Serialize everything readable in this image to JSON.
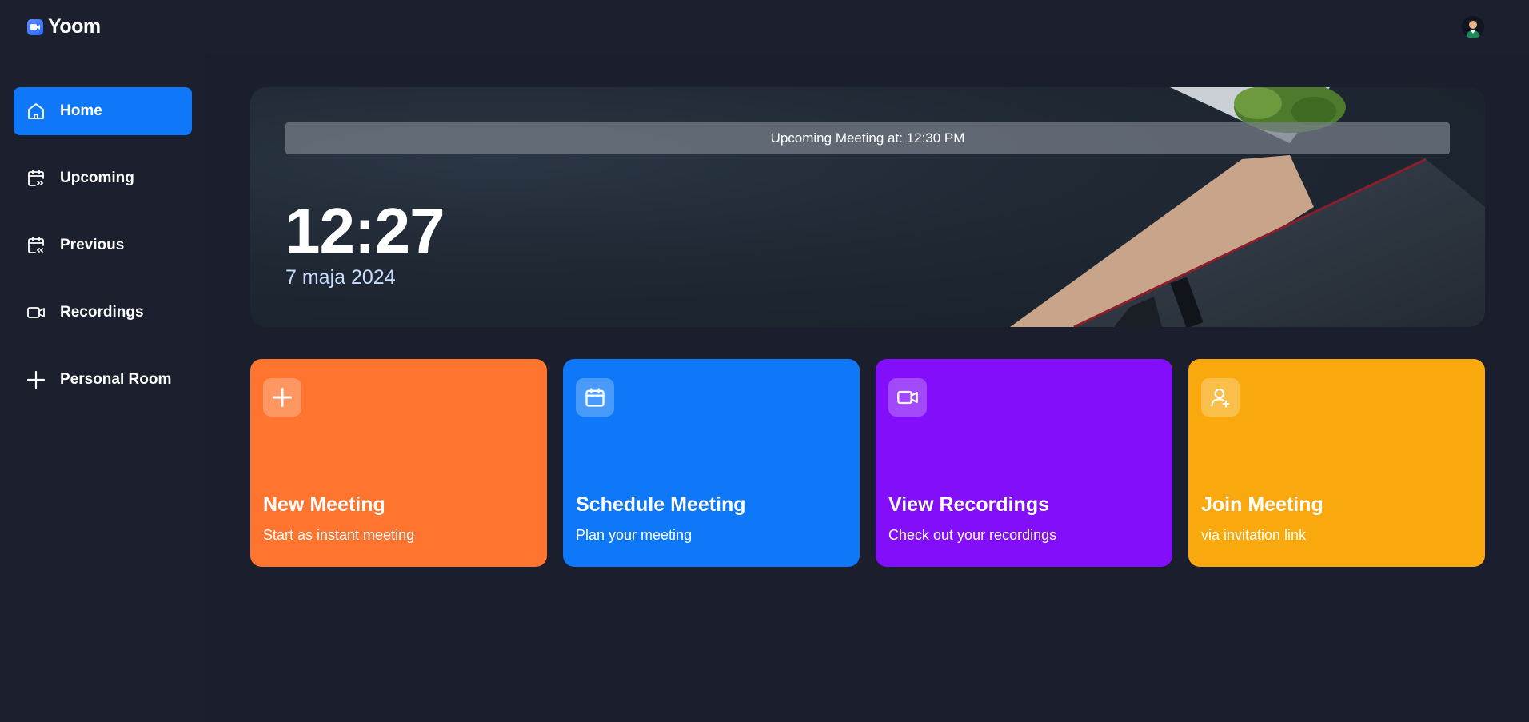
{
  "app": {
    "name": "Yoom"
  },
  "sidebar": {
    "items": [
      {
        "label": "Home",
        "icon": "home-icon",
        "active": true
      },
      {
        "label": "Upcoming",
        "icon": "calendar-forward-icon",
        "active": false
      },
      {
        "label": "Previous",
        "icon": "calendar-back-icon",
        "active": false
      },
      {
        "label": "Recordings",
        "icon": "video-icon",
        "active": false
      },
      {
        "label": "Personal Room",
        "icon": "plus-icon",
        "active": false
      }
    ]
  },
  "hero": {
    "banner": "Upcoming Meeting at: 12:30 PM",
    "time": "12:27",
    "date": "7 maja 2024"
  },
  "cards": [
    {
      "title": "New Meeting",
      "subtitle": "Start as instant meeting",
      "icon": "plus-icon",
      "color": "#ff742e"
    },
    {
      "title": "Schedule Meeting",
      "subtitle": "Plan your meeting",
      "icon": "calendar-icon",
      "color": "#0e78f9"
    },
    {
      "title": "View Recordings",
      "subtitle": "Check out your recordings",
      "icon": "video-icon",
      "color": "#830ef9"
    },
    {
      "title": "Join Meeting",
      "subtitle": "via invitation link",
      "icon": "user-plus-icon",
      "color": "#f9a90e"
    }
  ],
  "colors": {
    "background": "#1c1f2e",
    "accent": "#0e78f9"
  }
}
